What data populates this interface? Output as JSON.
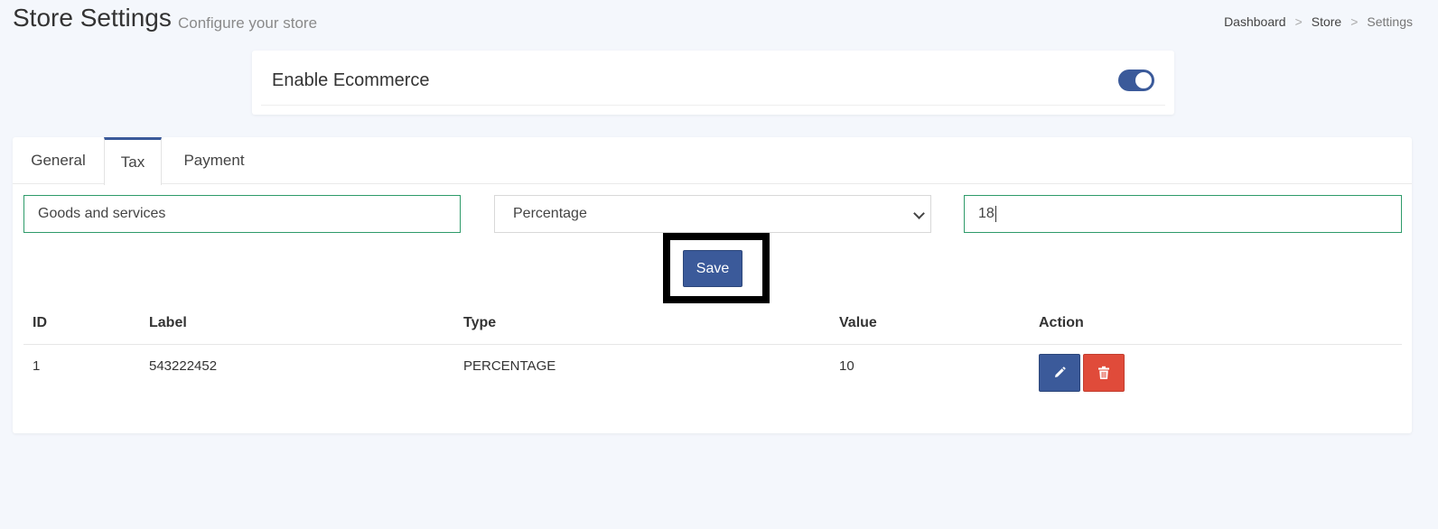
{
  "header": {
    "title": "Store Settings",
    "subtitle": "Configure your store",
    "breadcrumb": [
      {
        "label": "Dashboard"
      },
      {
        "label": "Store"
      },
      {
        "label": "Settings"
      }
    ],
    "separator": ">"
  },
  "ecommerce": {
    "label": "Enable Ecommerce",
    "enabled": true
  },
  "tabs": [
    {
      "label": "General",
      "active": false
    },
    {
      "label": "Tax",
      "active": true
    },
    {
      "label": "Payment",
      "active": false
    }
  ],
  "tax_form": {
    "label_value": "Goods and services",
    "type_value": "Percentage",
    "amount_value": "18",
    "save_label": "Save"
  },
  "table": {
    "columns": [
      "ID",
      "Label",
      "Type",
      "Value",
      "Action"
    ],
    "rows": [
      {
        "id": "1",
        "label": "543222452",
        "type": "PERCENTAGE",
        "value": "10"
      }
    ]
  },
  "colors": {
    "primary": "#3b5a9a",
    "danger": "#e04b3a",
    "valid_border": "#2e9b6a"
  },
  "icons": {
    "edit": "pencil-icon",
    "delete": "trash-icon",
    "select": "chevron-down-icon"
  }
}
